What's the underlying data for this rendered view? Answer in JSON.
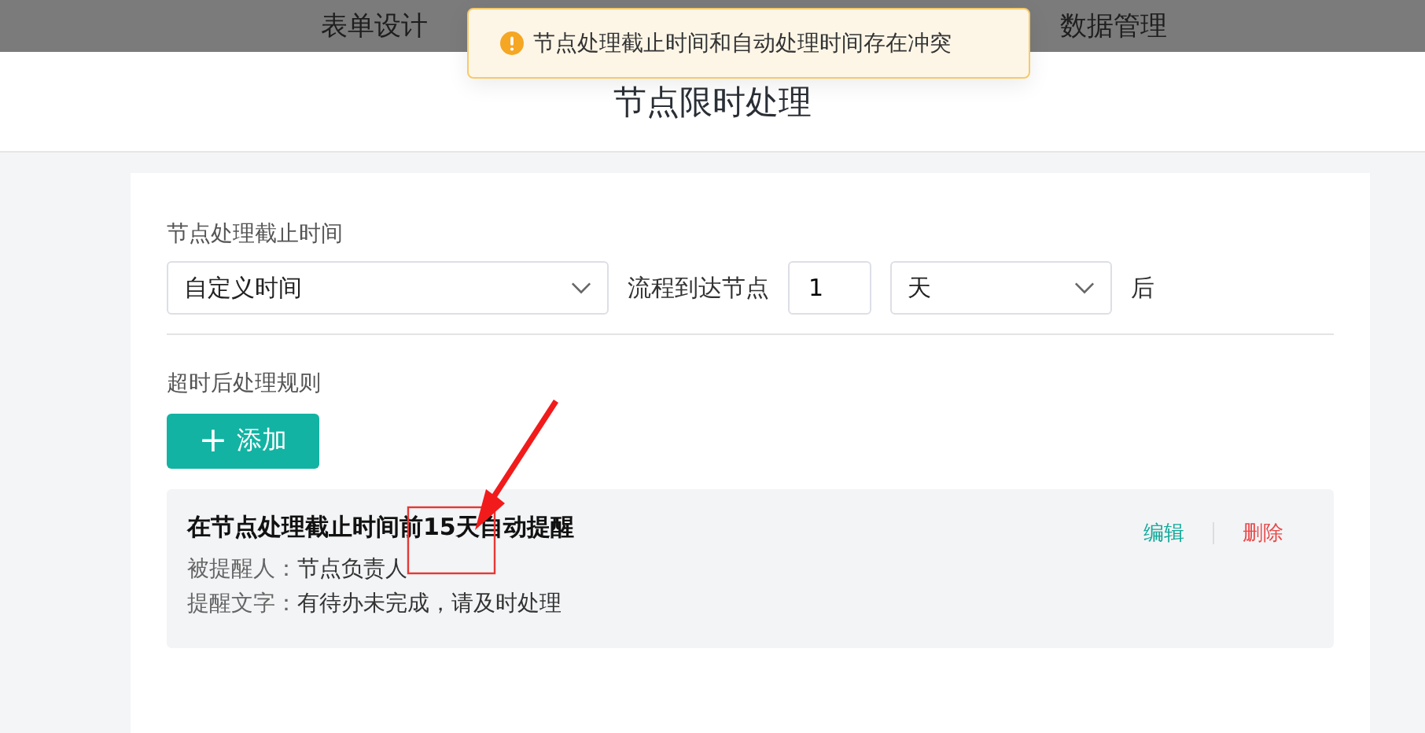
{
  "nav": {
    "items": [
      {
        "label": "表单设计"
      },
      {
        "label": "数据管理"
      }
    ]
  },
  "toast": {
    "kind": "warning",
    "text": "节点处理截止时间和自动处理时间存在冲突"
  },
  "page": {
    "title": "节点限时处理"
  },
  "deadline": {
    "label": "节点处理截止时间",
    "mode": {
      "value": "自定义时间"
    },
    "prefix": "流程到达节点",
    "amount": {
      "value": "1"
    },
    "unit": {
      "value": "天"
    },
    "suffix": "后"
  },
  "rules": {
    "label": "超时后处理规则",
    "add_button": {
      "icon": "+",
      "label": "添加"
    },
    "items": [
      {
        "title": "在节点处理截止时间前15天自动提醒",
        "fields": [
          {
            "label": "被提醒人：",
            "value": "节点负责人"
          },
          {
            "label": "提醒文字：",
            "value": "有待办未完成，请及时处理"
          }
        ],
        "actions": [
          {
            "kind": "edit",
            "label": "编辑"
          },
          {
            "kind": "delete",
            "label": "删除"
          }
        ]
      }
    ]
  }
}
